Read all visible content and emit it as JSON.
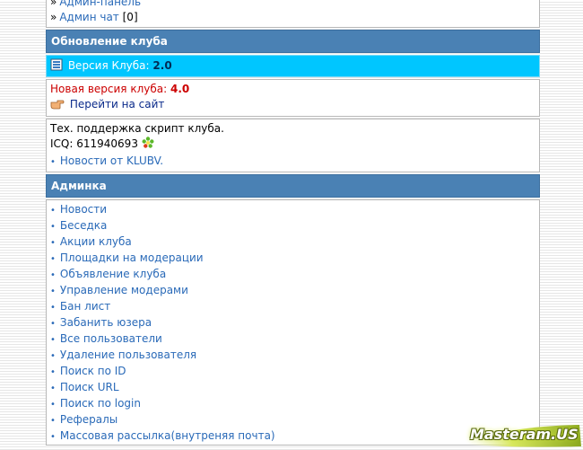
{
  "top_links": {
    "admin_panel": "Админ-панель",
    "admin_chat": "Админ чат",
    "admin_chat_count": "[0]"
  },
  "update_section": {
    "title": "Обновление клуба",
    "version_label": "Версия Клуба:",
    "version_value": "2.0",
    "new_version_label": "Новая версия клуба:",
    "new_version_value": "4.0",
    "go_to_site": "Перейти на сайт",
    "support_text": "Тех. поддержка скрипт клуба.",
    "icq_label": "ICQ:",
    "icq_number": "611940693",
    "news_link": "Новости от KLUBV."
  },
  "admin_section": {
    "title": "Админка",
    "items": [
      {
        "label": "Новости"
      },
      {
        "label": "Беседка"
      },
      {
        "label": "Акции клуба"
      },
      {
        "label": "Площадки на модерации"
      },
      {
        "label": "Объявление клуба"
      },
      {
        "label": "Управление модерами"
      },
      {
        "label": "Бан лист"
      },
      {
        "label": "Забанить юзера"
      },
      {
        "label": "Все пользователи"
      },
      {
        "label": "Удаление пользователя"
      },
      {
        "label": "Поиск по ID"
      },
      {
        "label": "Поиск URL"
      },
      {
        "label": "Поиск по login"
      },
      {
        "label": "Рефералы"
      },
      {
        "label": "Массовая рассылка(внутреняя почта)"
      }
    ]
  },
  "watermark": {
    "text": "Masteram.US"
  },
  "colors": {
    "header_bg": "#4a81b4",
    "version_bar_bg": "#00c6ff",
    "link": "#2a6ab8",
    "new_version_text": "#cc0000"
  }
}
